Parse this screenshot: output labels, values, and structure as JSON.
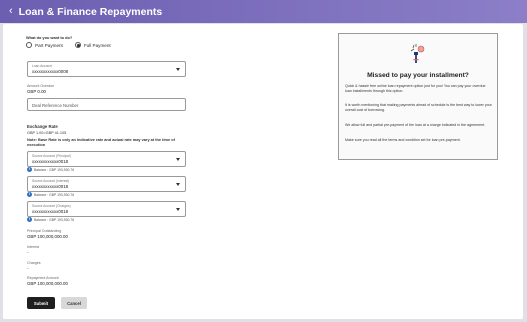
{
  "header": {
    "back_glyph": "‹",
    "title": "Loan & Finance Repayments"
  },
  "form": {
    "question": "What do you want to do?",
    "options": [
      {
        "label": "Part Payment",
        "selected": false
      },
      {
        "label": "Full Payment",
        "selected": true
      }
    ],
    "loan_account": {
      "label": "Loan Account",
      "value": "xxxxxxxxxxxx0008"
    },
    "amount_overdue": {
      "label": "Amount Overdue",
      "value": "GBP 0.00"
    },
    "deal_reference": {
      "placeholder": "Deal Reference Number"
    },
    "exchange_rate": {
      "label": "Exchange Rate",
      "value": "GBP 1.00=GBP 41.105",
      "note": "Note: Base Rate is only an indicative rate and actual rate may vary at the time of execution"
    },
    "source_principal": {
      "label": "Source Account (Principal)",
      "value": "xxxxxxxxxxxx0018",
      "balance": "Balance : GBP 193,930.76"
    },
    "source_interest": {
      "label": "Source Account (Interest)",
      "value": "xxxxxxxxxxxx0018",
      "balance": "Balance : GBP 193,930.76"
    },
    "source_charges": {
      "label": "Source Account (Charges)",
      "value": "xxxxxxxxxxxx0018",
      "balance": "Balance : GBP 193,930.76"
    },
    "principal_outstanding": {
      "label": "Principal Outstanding",
      "value": "GBP 100,000,000.00"
    },
    "interest": {
      "label": "Interest",
      "value": "-"
    },
    "charges": {
      "label": "Charges",
      "value": "-"
    },
    "repayment_amount": {
      "label": "Repayment Amount",
      "value": "GBP 100,000,000.00"
    },
    "submit_label": "Submit",
    "cancel_label": "Cancel"
  },
  "panel": {
    "icon": "hand-coin-icon",
    "title": "Missed to pay your installment?",
    "p1": "Quick & hassle free online loan repayment option just for you! You can pay your overdue loan installments through this option.",
    "p2": "It is worth mentioning that making payments ahead of schedule is the best way to lower your overall cost of borrowing.",
    "p3": "We allow full and partial pre-payment of the loan at a charge indicated in the agreement.",
    "p4": "Make sure you read all the terms and condition set for loan pre-payment."
  },
  "colors": {
    "header_start": "#6c5eb0",
    "header_end": "#8c7fc8",
    "primary_button": "#1f1f1f",
    "info": "#2d6fc0"
  }
}
